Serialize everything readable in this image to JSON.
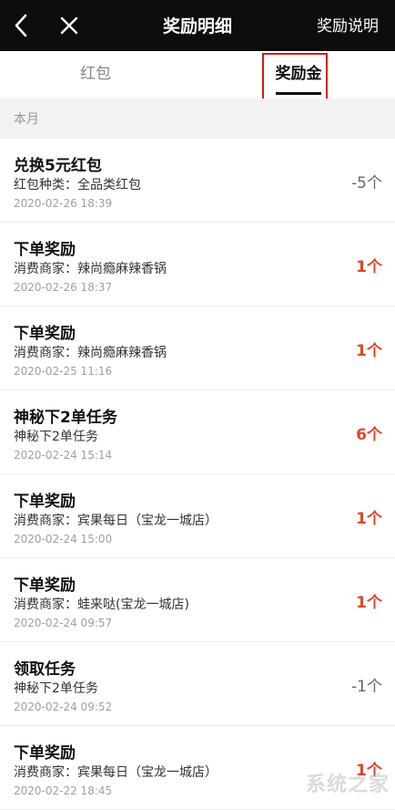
{
  "colors": {
    "navbar_bg": "#0d0d0d",
    "accent_red": "#e0452a",
    "highlight_box": "#d9161b"
  },
  "navbar": {
    "back_icon": "chevron-left-icon",
    "close_icon": "close-icon",
    "title": "奖励明细",
    "right_label": "奖励说明"
  },
  "tabs": [
    {
      "label": "红包",
      "active": false
    },
    {
      "label": "奖励金",
      "active": true
    }
  ],
  "section": {
    "label": "本月"
  },
  "records": [
    {
      "title": "兑换5元红包",
      "subtitle": "红包种类：全品类红包",
      "time": "2020-02-26 18:39",
      "amount": "-5个",
      "kind": "negative"
    },
    {
      "title": "下单奖励",
      "subtitle": "消费商家：辣尚瘾麻辣香锅",
      "time": "2020-02-26 18:37",
      "amount": "1个",
      "kind": "positive"
    },
    {
      "title": "下单奖励",
      "subtitle": "消费商家：辣尚瘾麻辣香锅",
      "time": "2020-02-25 11:16",
      "amount": "1个",
      "kind": "positive"
    },
    {
      "title": "神秘下2单任务",
      "subtitle": "神秘下2单任务",
      "time": "2020-02-24 15:14",
      "amount": "6个",
      "kind": "positive"
    },
    {
      "title": "下单奖励",
      "subtitle": "消费商家：宾果每日（宝龙一城店）",
      "time": "2020-02-24 15:00",
      "amount": "1个",
      "kind": "positive"
    },
    {
      "title": "下单奖励",
      "subtitle": "消费商家：蛙来哒(宝龙一城店)",
      "time": "2020-02-24 09:57",
      "amount": "1个",
      "kind": "positive"
    },
    {
      "title": "领取任务",
      "subtitle": "神秘下2单任务",
      "time": "2020-02-24 09:52",
      "amount": "-1个",
      "kind": "negative"
    },
    {
      "title": "下单奖励",
      "subtitle": "消费商家：宾果每日（宝龙一城店）",
      "time": "2020-02-22 18:45",
      "amount": "1个",
      "kind": "positive"
    }
  ],
  "watermark": "系统之家"
}
